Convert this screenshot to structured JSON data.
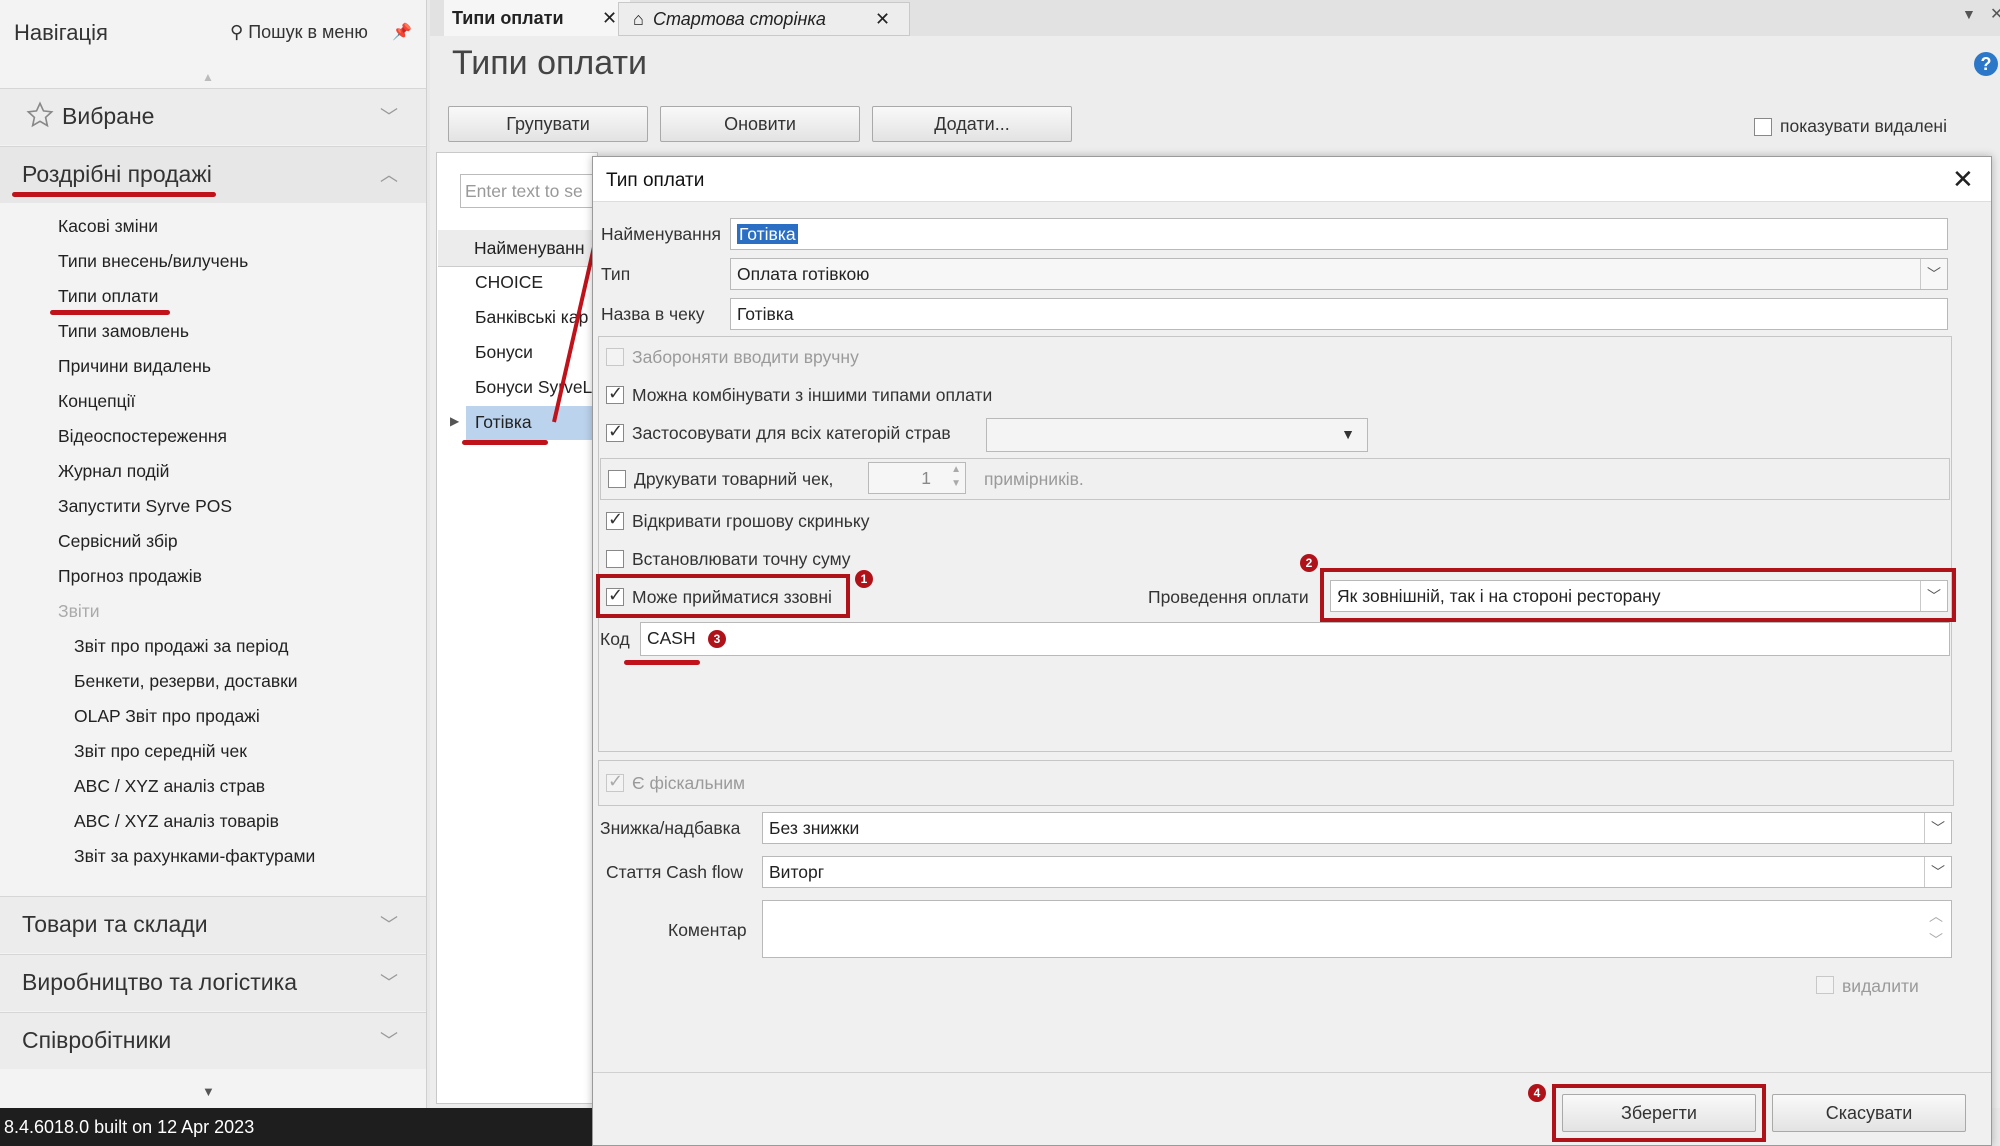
{
  "nav": {
    "title": "Навігація",
    "search": "Пошук в меню",
    "favorites": "Вибране",
    "retail": "Роздрібні продажі",
    "items": [
      "Касові зміни",
      "Типи внесень/вилучень",
      "Типи оплати",
      "Типи замовлень",
      "Причини видалень",
      "Концепції",
      "Відеоспостереження",
      "Журнал подій",
      "Запустити Syrve POS",
      "Сервісний збір",
      "Прогноз продажів"
    ],
    "reports_label": "Звіти",
    "reports": [
      "Звіт про продажі за період",
      "Бенкети, резерви, доставки",
      "OLAP Звіт про продажі",
      "Звіт про середній чек",
      "ABC / XYZ аналіз страв",
      "ABC / XYZ аналіз товарів",
      "Звіт за рахунками-фактурами"
    ],
    "sections": [
      "Товари та склади",
      "Виробництво та логістика",
      "Співробітники"
    ]
  },
  "tabs": [
    {
      "label": "Типи оплати",
      "active": true
    },
    {
      "label": "Стартова сторінка",
      "active": false
    }
  ],
  "page": {
    "title": "Типи оплати",
    "buttons": {
      "group": "Групувати",
      "refresh": "Оновити",
      "add": "Додати..."
    },
    "show_deleted": "показувати видалені",
    "filter_placeholder": "Enter text to se",
    "list_header": "Найменуванн",
    "rows": [
      "CHOICE",
      "Банківські кар",
      "Бонуси",
      "Бонуси SyrveL",
      "Готівка"
    ]
  },
  "dialog": {
    "title": "Тип оплати",
    "name_label": "Найменування",
    "name_value": "Готівка",
    "type_label": "Тип",
    "type_value": "Оплата готівкою",
    "receipt_label": "Назва в чеку",
    "receipt_value": "Готівка",
    "forbid_manual": "Забороняти вводити вручну",
    "combine": "Можна комбінувати з іншими типами оплати",
    "apply_all": "Застосовувати для всіх категорій страв",
    "print_check": "Друкувати товарний чек,",
    "copies_value": "1",
    "copies_suffix": "примірників.",
    "open_drawer": "Відкривати грошову скриньку",
    "exact_sum": "Встановлювати точну суму",
    "external": "Може прийматися ззовні",
    "processing_label": "Проведення оплати",
    "processing_value": "Як зовнішній, так і на стороні ресторану",
    "code_label": "Код",
    "code_value": "CASH",
    "fiscal": "Є фіскальним",
    "discount_label": "Знижка/надбавка",
    "discount_value": "Без знижки",
    "cashflow_label": "Стаття Cash flow",
    "cashflow_value": "Виторг",
    "comment_label": "Коментар",
    "delete_label": "видалити",
    "save": "Зберегти",
    "cancel": "Скасувати",
    "badges": [
      "1",
      "2",
      "3",
      "4"
    ]
  },
  "status": "8.4.6018.0 built on 12 Apr 2023",
  "colors": {
    "accent_red": "#b0121a",
    "selection": "#2b6fc4"
  }
}
